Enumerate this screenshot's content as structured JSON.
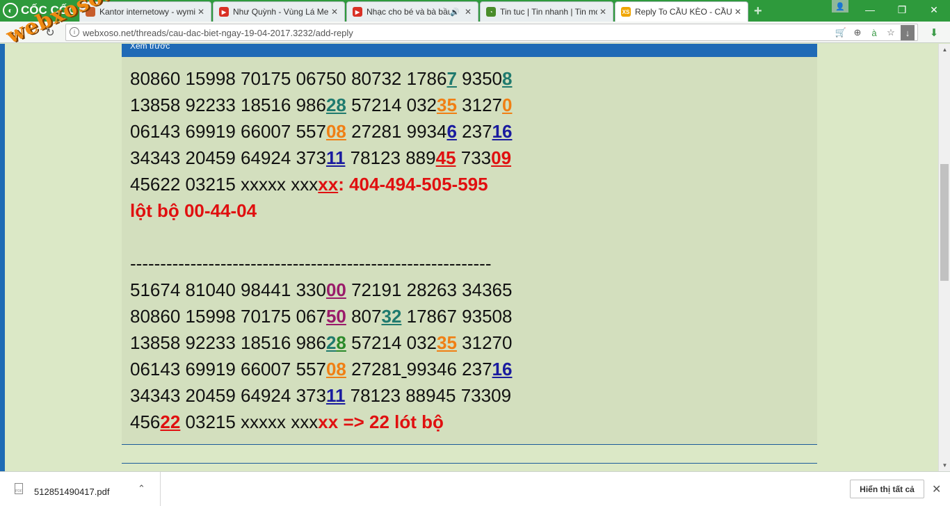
{
  "browser": {
    "brand": "CỐC CỐC",
    "tabs": [
      {
        "title": "Kantor internetowy - wymi",
        "favicon_color": "#c75d2c",
        "favicon_text": ""
      },
      {
        "title": "Như Quỳnh - Vùng Lá Me",
        "favicon_color": "#d93025",
        "favicon_text": "▶"
      },
      {
        "title": "Nhạc cho bé và bà bầu",
        "favicon_color": "#d93025",
        "favicon_text": "▶"
      },
      {
        "title": "Tin tuc | Tin nhanh | Tin mới",
        "favicon_color": "#4a8c2a",
        "favicon_text": "◔"
      },
      {
        "title": "Reply To CẦU KÈO - CẦU Đ",
        "favicon_color": "#f0a500",
        "favicon_text": "XS",
        "active": true
      }
    ],
    "tab_close_glyph": "✕",
    "tab_mute_glyph": "🔊",
    "new_tab_glyph": "+",
    "profile_glyph": "👤",
    "window_buttons": [
      "—",
      "❐",
      "✕"
    ],
    "nav": {
      "back": "←",
      "forward": "→",
      "reload": "↻",
      "home": "⌂"
    },
    "url": "webxoso.net/threads/cau-dac-biet-ngay-19-04-2017.3232/add-reply",
    "omnibox_icons": [
      "cart-icon",
      "zoom-icon",
      "translate-icon",
      "star-icon",
      "download-arrow-icon"
    ],
    "omnibox_glyphs": [
      "🛒",
      "⊕",
      "à",
      "☆",
      "↓"
    ],
    "download_glyph": "⬇"
  },
  "watermark": "webxoso.net",
  "content": {
    "preview_label": "Xem trước",
    "lines": [
      [
        {
          "t": "80860 15998 70175 06750 80732 1786"
        },
        {
          "t": "7",
          "c": "teal"
        },
        {
          "t": " 9350"
        },
        {
          "t": "8",
          "c": "teal"
        }
      ],
      [
        {
          "t": "13858 92233 18516 986"
        },
        {
          "t": "28",
          "c": "teal"
        },
        {
          "t": " 57214 032"
        },
        {
          "t": "35",
          "c": "orange"
        },
        {
          "t": " 3127"
        },
        {
          "t": "0",
          "c": "orange"
        }
      ],
      [
        {
          "t": "06143 69919 66007 557"
        },
        {
          "t": "08",
          "c": "orange"
        },
        {
          "t": " 27281 9934"
        },
        {
          "t": "6",
          "c": "navy"
        },
        {
          "t": " 237"
        },
        {
          "t": "16",
          "c": "navy"
        }
      ],
      [
        {
          "t": "34343 20459 64924 373"
        },
        {
          "t": "11",
          "c": "navy"
        },
        {
          "t": " 78123 889"
        },
        {
          "t": "45",
          "c": "red"
        },
        {
          "t": " 733"
        },
        {
          "t": "09",
          "c": "red"
        }
      ],
      [
        {
          "t": "45622 03215 xxxxx xxx"
        },
        {
          "t": "xx",
          "c": "red"
        },
        {
          "t": ": 404-494-505-595",
          "c": "boldred"
        }
      ],
      [
        {
          "t": "lột bộ 00-44-04",
          "c": "boldred"
        }
      ],
      [
        {
          "t": ""
        }
      ],
      [
        {
          "t": "------------------------------------------------------------"
        }
      ],
      [
        {
          "t": "51674 81040 98441 330"
        },
        {
          "t": "00",
          "c": "purple"
        },
        {
          "t": " 72191 28263 34365"
        }
      ],
      [
        {
          "t": "80860 15998 70175 067"
        },
        {
          "t": "50",
          "c": "purple"
        },
        {
          "t": " 807"
        },
        {
          "t": "32",
          "c": "teal"
        },
        {
          "t": " 17867 93508"
        }
      ],
      [
        {
          "t": "13858 92233 18516 986"
        },
        {
          "t": "2",
          "c": "teal"
        },
        {
          "t": "8",
          "c": "green"
        },
        {
          "t": " 57214 032"
        },
        {
          "t": "35",
          "c": "orange"
        },
        {
          "t": " 31270"
        }
      ],
      [
        {
          "t": "06143 69919 66007 557"
        },
        {
          "t": "08",
          "c": "orange"
        },
        {
          "t": " 27281"
        },
        {
          "t": " ",
          "c": "plainu"
        },
        {
          "t": "99346 237"
        },
        {
          "t": "16",
          "c": "navy"
        }
      ],
      [
        {
          "t": "34343 20459 64924 373"
        },
        {
          "t": "11",
          "c": "navy"
        },
        {
          "t": " 78123 88945 73309"
        }
      ],
      [
        {
          "t": "456"
        },
        {
          "t": "22",
          "c": "red"
        },
        {
          "t": " 03215 xxxxx xxx"
        },
        {
          "t": "xx => 22 lót bộ",
          "c": "boldred"
        }
      ]
    ]
  },
  "download_shelf": {
    "file_name": "512851490417.pdf",
    "file_icon_text": "PDF",
    "chevron": "⌃",
    "show_all_label": "Hiển thị tất cả",
    "close_glyph": "✕"
  },
  "scrollbar": {
    "up": "▲",
    "down": "▼"
  }
}
